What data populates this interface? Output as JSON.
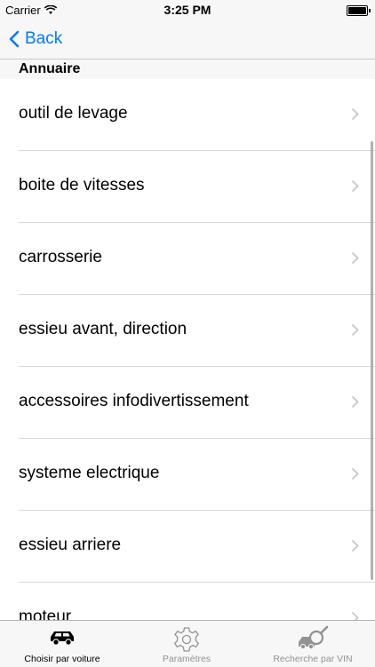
{
  "status_bar": {
    "carrier": "Carrier",
    "time": "3:25 PM"
  },
  "nav": {
    "back_label": "Back"
  },
  "section": {
    "title": "Annuaire"
  },
  "list": {
    "items": [
      {
        "label": "outil de levage"
      },
      {
        "label": "boite de vitesses"
      },
      {
        "label": "carrosserie"
      },
      {
        "label": "essieu avant, direction"
      },
      {
        "label": "accessoires infodivertissement"
      },
      {
        "label": "systeme electrique"
      },
      {
        "label": "essieu arriere"
      },
      {
        "label": "moteur"
      }
    ]
  },
  "tabbar": {
    "tabs": [
      {
        "label": "Choisir par voiture",
        "icon": "car-icon",
        "selected": true
      },
      {
        "label": "Paramètres",
        "icon": "gear-icon",
        "selected": false
      },
      {
        "label": "Recherche par VIN",
        "icon": "vin-search-icon",
        "selected": false
      }
    ]
  },
  "colors": {
    "accent": "#007aff",
    "separator": "#d8d8dc",
    "bar_background": "#f7f7f7",
    "inactive_tab": "#929292"
  }
}
